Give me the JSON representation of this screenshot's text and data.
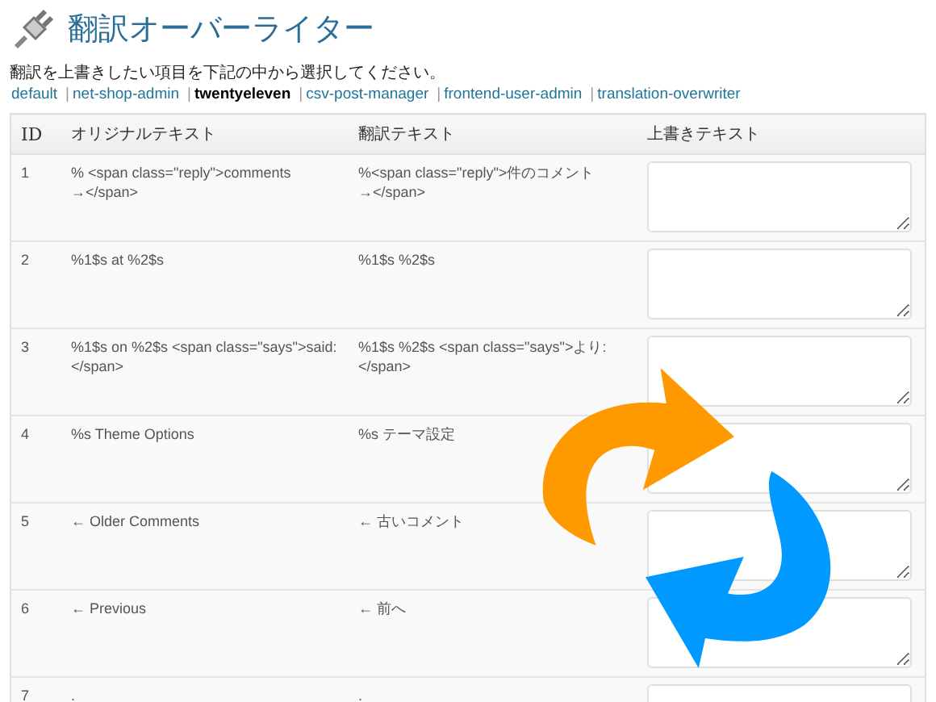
{
  "page": {
    "title": "翻訳オーバーライター",
    "description": "翻訳を上書きしたい項目を下記の中から選択してください。"
  },
  "domains": [
    {
      "label": "default",
      "selected": false
    },
    {
      "separator": "|",
      "label": "net-shop-admin",
      "selected": false
    },
    {
      "separator": "|",
      "label": "twentyeleven",
      "selected": true
    },
    {
      "separator": "|",
      "label": "csv-post-manager",
      "selected": false
    },
    {
      "separator": "|",
      "label": "frontend-user-admin",
      "selected": false
    },
    {
      "separator": "|",
      "label": "translation-overwriter",
      "selected": false
    }
  ],
  "table": {
    "columns": [
      "ID",
      "オリジナルテキスト",
      "翻訳テキスト",
      "上書きテキスト"
    ],
    "rows": [
      {
        "id": "1",
        "original": "% <span class=\"reply\">comments →</span>",
        "translation": "%<span class=\"reply\">件のコメント →</span>"
      },
      {
        "id": "2",
        "original": "%1$s at %2$s",
        "translation": "%1$s %2$s"
      },
      {
        "id": "3",
        "original": "%1$s on %2$s <span class=\"says\">said: </span>",
        "translation": "%1$s %2$s <span class=\"says\">より: </span>"
      },
      {
        "id": "4",
        "original": "%s Theme Options",
        "translation": "%s テーマ設定"
      },
      {
        "id": "5",
        "original": "← Older Comments",
        "translation": "← 古いコメント"
      },
      {
        "id": "6",
        "original": "← Previous",
        "translation": "← 前へ"
      },
      {
        "id": "7",
        "original": ".",
        "translation": "."
      }
    ]
  }
}
